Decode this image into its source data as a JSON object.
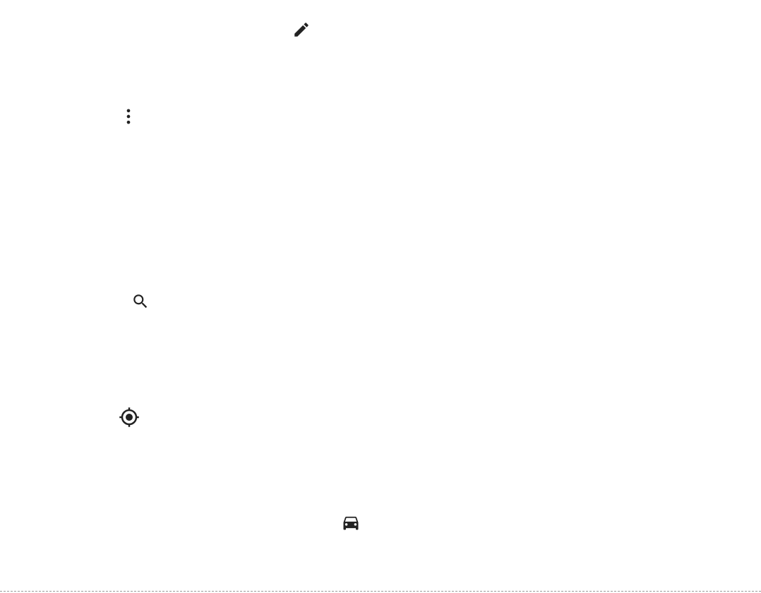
{
  "screen": {
    "background_color": "#ffffff",
    "icon_color": "#222222"
  },
  "icons": {
    "edit": "pencil-icon",
    "more": "more-vertical-icon",
    "search": "search-icon",
    "location": "my-location-icon",
    "drive": "car-icon"
  }
}
